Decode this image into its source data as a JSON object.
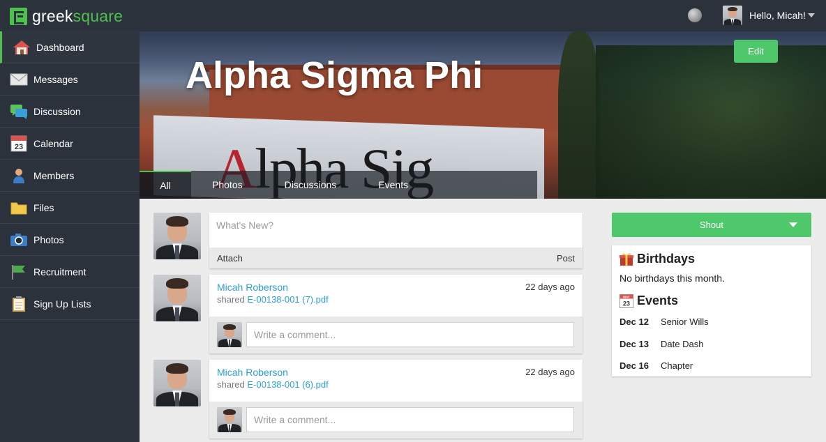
{
  "app": {
    "logo_text_1": "greek",
    "logo_text_2": "square",
    "greeting": "Hello, Micah!"
  },
  "sidebar": {
    "items": [
      {
        "label": "Dashboard",
        "icon": "house-icon",
        "active": true
      },
      {
        "label": "Messages",
        "icon": "envelope-icon"
      },
      {
        "label": "Discussion",
        "icon": "chat-bubbles-icon"
      },
      {
        "label": "Calendar",
        "icon": "calendar-icon"
      },
      {
        "label": "Members",
        "icon": "person-icon"
      },
      {
        "label": "Files",
        "icon": "folder-icon"
      },
      {
        "label": "Photos",
        "icon": "camera-icon"
      },
      {
        "label": "Recruitment",
        "icon": "flag-icon"
      },
      {
        "label": "Sign Up Lists",
        "icon": "clipboard-icon"
      }
    ]
  },
  "cover": {
    "title": "Alpha Sigma Phi",
    "edit_label": "Edit",
    "wall_text_a": "A",
    "wall_text_rest": "lpha Sig",
    "tabs": [
      "All",
      "Photos",
      "Discussions",
      "Events"
    ]
  },
  "compose": {
    "placeholder": "What's New?",
    "attach_label": "Attach",
    "post_label": "Post"
  },
  "feed": [
    {
      "author": "Micah Roberson",
      "time": "22 days ago",
      "action": "shared",
      "file": "E-00138-001 (7).pdf",
      "comment_placeholder": "Write a comment..."
    },
    {
      "author": "Micah Roberson",
      "time": "22 days ago",
      "action": "shared",
      "file": "E-00138-001 (6).pdf",
      "comment_placeholder": "Write a comment..."
    }
  ],
  "right": {
    "shout_label": "Shout",
    "birthdays_title": "Birthdays",
    "birthdays_text": "No birthdays this month.",
    "events_title": "Events",
    "calendar_icon_month": "MAY",
    "calendar_icon_day": "23",
    "events": [
      {
        "date": "Dec 12",
        "name": "Senior Wills"
      },
      {
        "date": "Dec 13",
        "name": "Date Dash"
      },
      {
        "date": "Dec 16",
        "name": "Chapter"
      }
    ]
  },
  "colors": {
    "accent": "#4ec04e",
    "button": "#4ec86a",
    "link": "#2a9fd6",
    "nav_bg": "#2c323c"
  }
}
